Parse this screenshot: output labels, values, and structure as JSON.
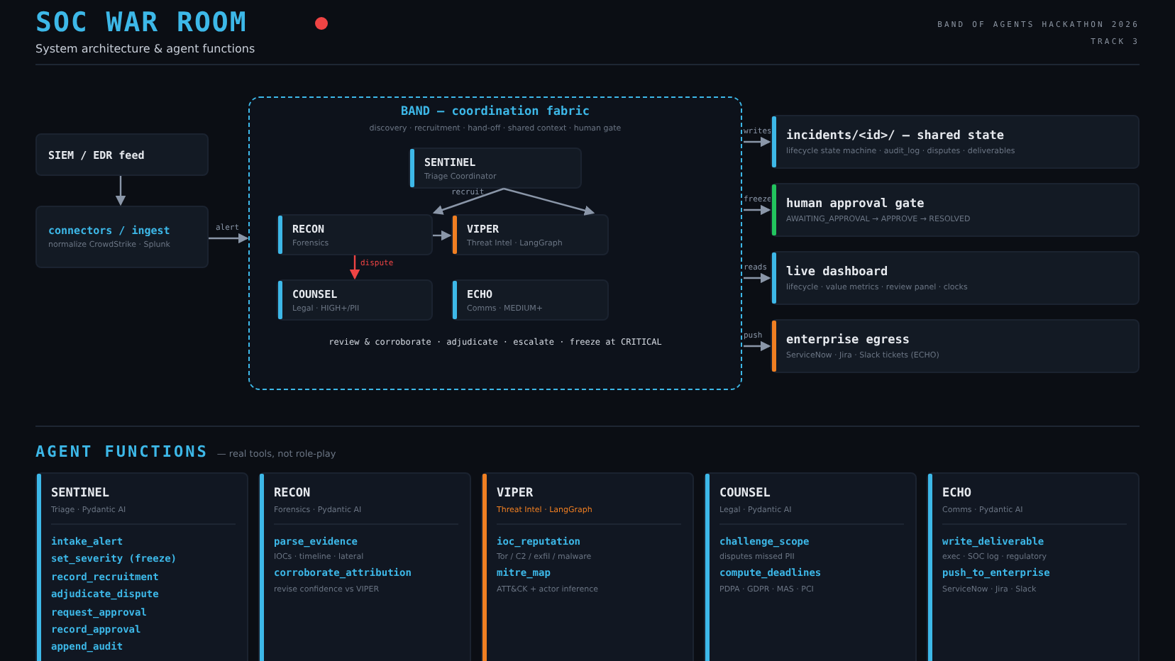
{
  "header": {
    "title": "SOC WAR ROOM",
    "subtitle": "System architecture & agent functions",
    "event": "BAND OF AGENTS HACKATHON 2026",
    "track": "TRACK 3"
  },
  "diagram": {
    "sources": [
      {
        "title": "SIEM / EDR feed",
        "kind": "plain"
      },
      {
        "title": "connectors / ingest",
        "subtitle": "normalize CrowdStrike · Splunk",
        "kind": "accent"
      }
    ],
    "alert_label": "alert",
    "band": {
      "title": "BAND — coordination fabric",
      "subtitle": "discovery · recruitment · hand-off · shared context · human gate",
      "footer": "review & corroborate · adjudicate · escalate · freeze at CRITICAL",
      "recruit_label": "recruit",
      "dispute_label": "dispute",
      "agents": [
        {
          "name": "SENTINEL",
          "role": "Triage Coordinator",
          "color": "#3db8e8"
        },
        {
          "name": "RECON",
          "role": "Forensics",
          "color": "#3db8e8"
        },
        {
          "name": "VIPER",
          "role": "Threat Intel · LangGraph",
          "color": "#f07f22"
        },
        {
          "name": "COUNSEL",
          "role": "Legal · HIGH+/PII",
          "color": "#3db8e8"
        },
        {
          "name": "ECHO",
          "role": "Comms · MEDIUM+",
          "color": "#3db8e8"
        }
      ]
    },
    "outputs": [
      {
        "edge": "writes",
        "title": "incidents/<id>/ — shared state",
        "subtitle": "lifecycle state machine · audit_log · disputes · deliverables",
        "color": "#3db8e8"
      },
      {
        "edge": "freeze",
        "title": "human approval gate",
        "subtitle": "AWAITING_APPROVAL → APPROVE → RESOLVED",
        "color": "#22c55e"
      },
      {
        "edge": "reads",
        "title": "live dashboard",
        "subtitle": "lifecycle · value metrics · review panel · clocks",
        "color": "#3db8e8"
      },
      {
        "edge": "push",
        "title": "enterprise egress",
        "subtitle": "ServiceNow · Jira · Slack tickets (ECHO)",
        "color": "#f07f22"
      }
    ]
  },
  "functions": {
    "title": "AGENT FUNCTIONS",
    "tagline": "— real tools, not role-play",
    "cards": [
      {
        "name": "SENTINEL",
        "role": "Triage · Pydantic AI",
        "color": "#3db8e8",
        "role_accent": false,
        "tools": [
          {
            "name": "intake_alert"
          },
          {
            "name": "set_severity (freeze)"
          },
          {
            "name": "record_recruitment"
          },
          {
            "name": "adjudicate_dispute"
          },
          {
            "name": "request_approval"
          },
          {
            "name": "record_approval"
          },
          {
            "name": "append_audit"
          }
        ]
      },
      {
        "name": "RECON",
        "role": "Forensics · Pydantic AI",
        "color": "#3db8e8",
        "role_accent": false,
        "tools": [
          {
            "name": "parse_evidence",
            "note": "IOCs · timeline · lateral"
          },
          {
            "name": "corroborate_attribution",
            "note": "revise confidence vs VIPER"
          }
        ]
      },
      {
        "name": "VIPER",
        "role": "Threat Intel · LangGraph",
        "color": "#f07f22",
        "role_accent": true,
        "tools": [
          {
            "name": "ioc_reputation",
            "note": "Tor / C2 / exfil / malware"
          },
          {
            "name": "mitre_map",
            "note": "ATT&CK + actor inference"
          }
        ]
      },
      {
        "name": "COUNSEL",
        "role": "Legal · Pydantic AI",
        "color": "#3db8e8",
        "role_accent": false,
        "tools": [
          {
            "name": "challenge_scope",
            "note": "disputes missed PII"
          },
          {
            "name": "compute_deadlines",
            "note": "PDPA · GDPR · MAS · PCI"
          }
        ]
      },
      {
        "name": "ECHO",
        "role": "Comms · Pydantic AI",
        "color": "#3db8e8",
        "role_accent": false,
        "tools": [
          {
            "name": "write_deliverable",
            "note": "exec · SOC log · regulatory"
          },
          {
            "name": "push_to_enterprise",
            "note": "ServiceNow · Jira · Slack"
          }
        ]
      }
    ]
  }
}
